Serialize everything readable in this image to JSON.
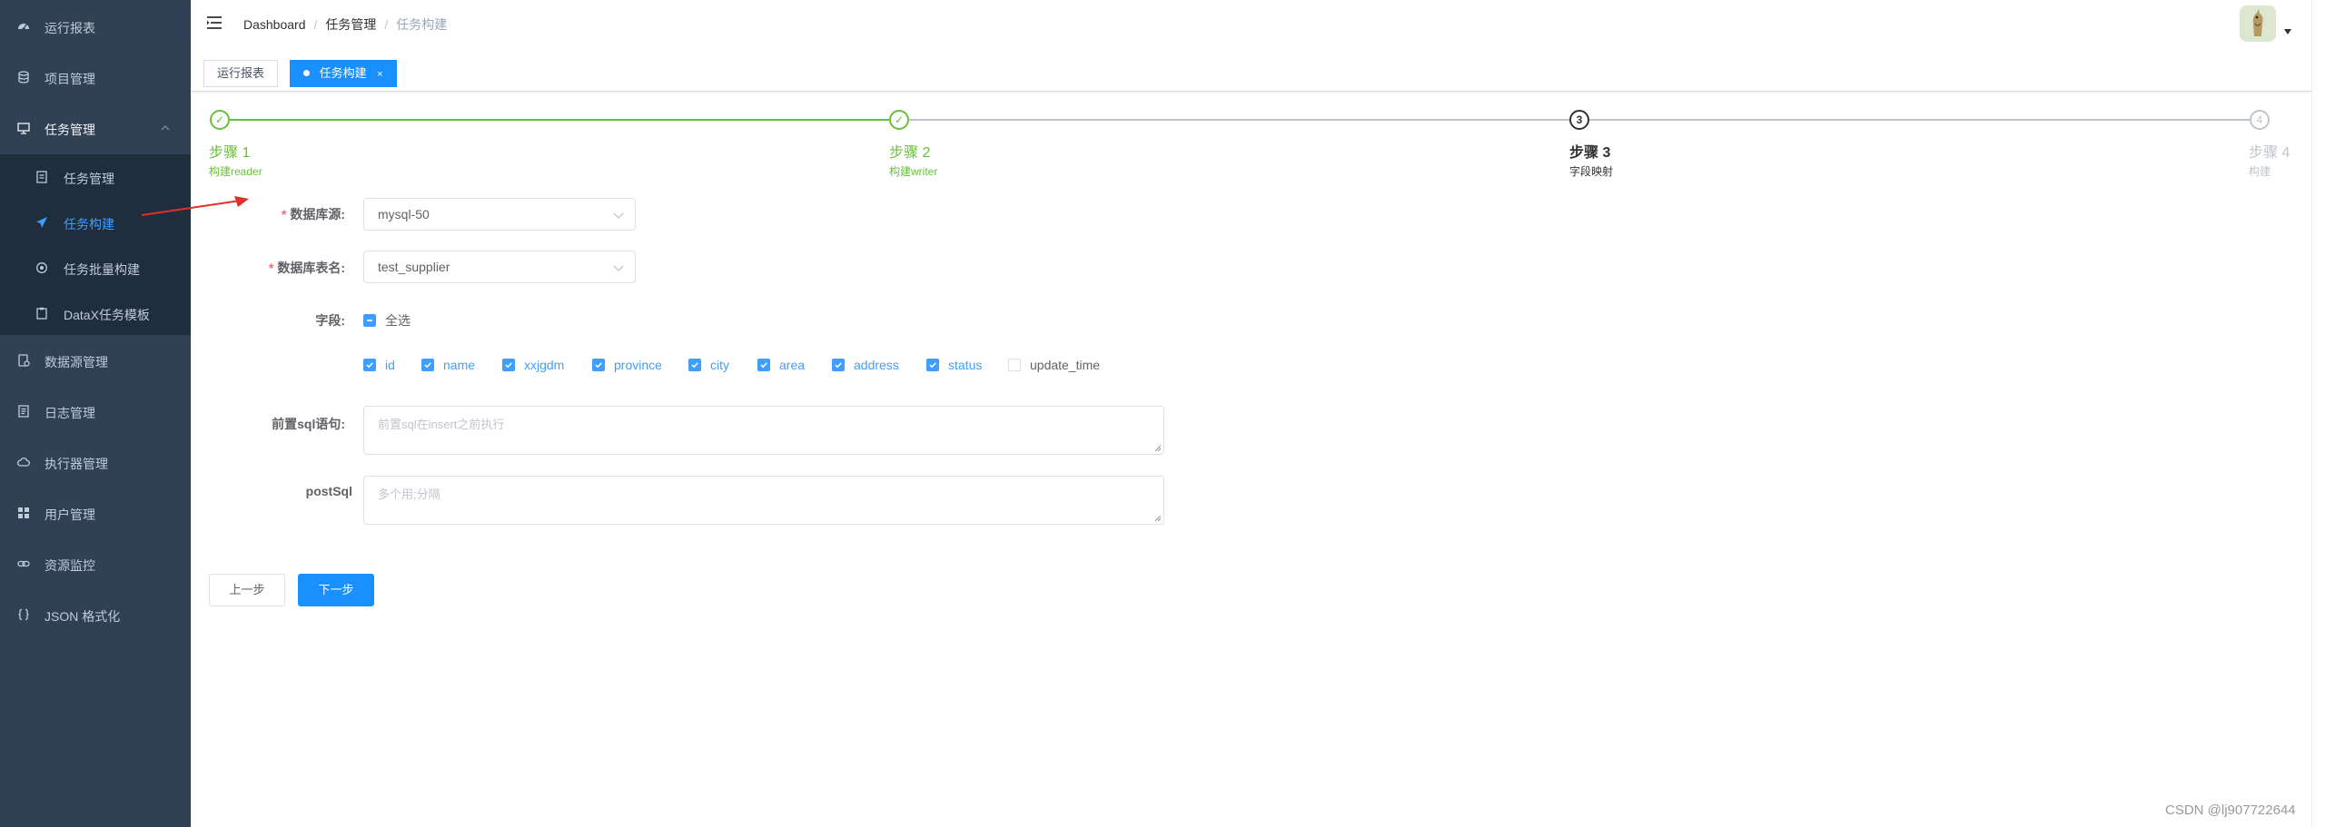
{
  "sidebar": {
    "items": [
      {
        "label": "运行报表",
        "icon": "dashboard-icon"
      },
      {
        "label": "项目管理",
        "icon": "database-icon"
      },
      {
        "label": "任务管理",
        "icon": "monitor-icon",
        "expanded": true
      },
      {
        "label": "数据源管理",
        "icon": "datasource-icon"
      },
      {
        "label": "日志管理",
        "icon": "log-document-icon"
      },
      {
        "label": "执行器管理",
        "icon": "executor-cloud-icon"
      },
      {
        "label": "用户管理",
        "icon": "user-grid-icon"
      },
      {
        "label": "资源监控",
        "icon": "link-icon"
      },
      {
        "label": "JSON 格式化",
        "icon": "braces-icon"
      }
    ],
    "task_submenu": [
      {
        "label": "任务管理",
        "icon": "task-list-icon"
      },
      {
        "label": "任务构建",
        "icon": "paper-plane-icon",
        "active": true
      },
      {
        "label": "任务批量构建",
        "icon": "batch-settings-icon"
      },
      {
        "label": "DataX任务模板",
        "icon": "template-clipboard-icon"
      }
    ]
  },
  "header": {
    "breadcrumb": [
      "Dashboard",
      "任务管理",
      "任务构建"
    ]
  },
  "tags": [
    {
      "label": "运行报表",
      "active": false
    },
    {
      "label": "任务构建",
      "active": true,
      "close": "×"
    }
  ],
  "steps": [
    {
      "icon_text": "✓",
      "title": "步骤 1",
      "desc": "构建reader",
      "status": "finish"
    },
    {
      "icon_text": "✓",
      "title": "步骤 2",
      "desc": "构建writer",
      "status": "finish"
    },
    {
      "icon_text": "3",
      "title": "步骤 3",
      "desc": "字段映射",
      "status": "process"
    },
    {
      "icon_text": "4",
      "title": "步骤 4",
      "desc": "构建",
      "status": "wait"
    }
  ],
  "form": {
    "datasource": {
      "label": "数据库源:",
      "value": "mysql-50"
    },
    "table": {
      "label": "数据库表名:",
      "value": "test_supplier"
    },
    "fields": {
      "label": "字段:",
      "select_all": "全选",
      "columns": [
        {
          "name": "id",
          "checked": true
        },
        {
          "name": "name",
          "checked": true
        },
        {
          "name": "xxjgdm",
          "checked": true
        },
        {
          "name": "province",
          "checked": true
        },
        {
          "name": "city",
          "checked": true
        },
        {
          "name": "area",
          "checked": true
        },
        {
          "name": "address",
          "checked": true
        },
        {
          "name": "status",
          "checked": true
        },
        {
          "name": "update_time",
          "checked": false
        }
      ]
    },
    "pre_sql": {
      "label": "前置sql语句:",
      "placeholder": "前置sql在insert之前执行"
    },
    "post_sql": {
      "label": "postSql",
      "placeholder": "多个用;分隔"
    }
  },
  "buttons": {
    "prev": "上一步",
    "next": "下一步"
  },
  "watermark": "CSDN @lj907722644",
  "colors": {
    "sidebar_bg": "#304156",
    "submenu_bg": "#1f2d3d",
    "accent": "#409eff",
    "primary": "#1890ff",
    "success": "#67c23a",
    "annotation_arrow": "#e0302a"
  }
}
